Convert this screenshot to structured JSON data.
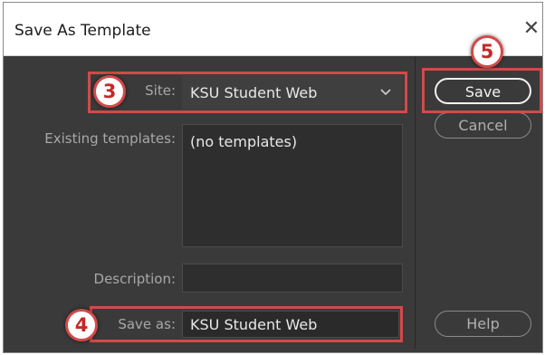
{
  "dialog": {
    "title": "Save As Template",
    "close_glyph": "✕"
  },
  "form": {
    "site_label": "Site:",
    "site_value": "KSU Student Web",
    "existing_templates_label": "Existing templates:",
    "existing_templates_items": [
      "(no templates)"
    ],
    "description_label": "Description:",
    "description_value": "",
    "save_as_label": "Save as:",
    "save_as_value": "KSU Student Web"
  },
  "buttons": {
    "save": "Save",
    "cancel": "Cancel",
    "help": "Help"
  },
  "callouts": {
    "step_site": "3",
    "step_save_as": "4",
    "step_save": "5"
  },
  "colors": {
    "highlight": "#d24a4a",
    "dialog_bg": "#3a3a3a",
    "field_bg": "#2e2e2e"
  }
}
